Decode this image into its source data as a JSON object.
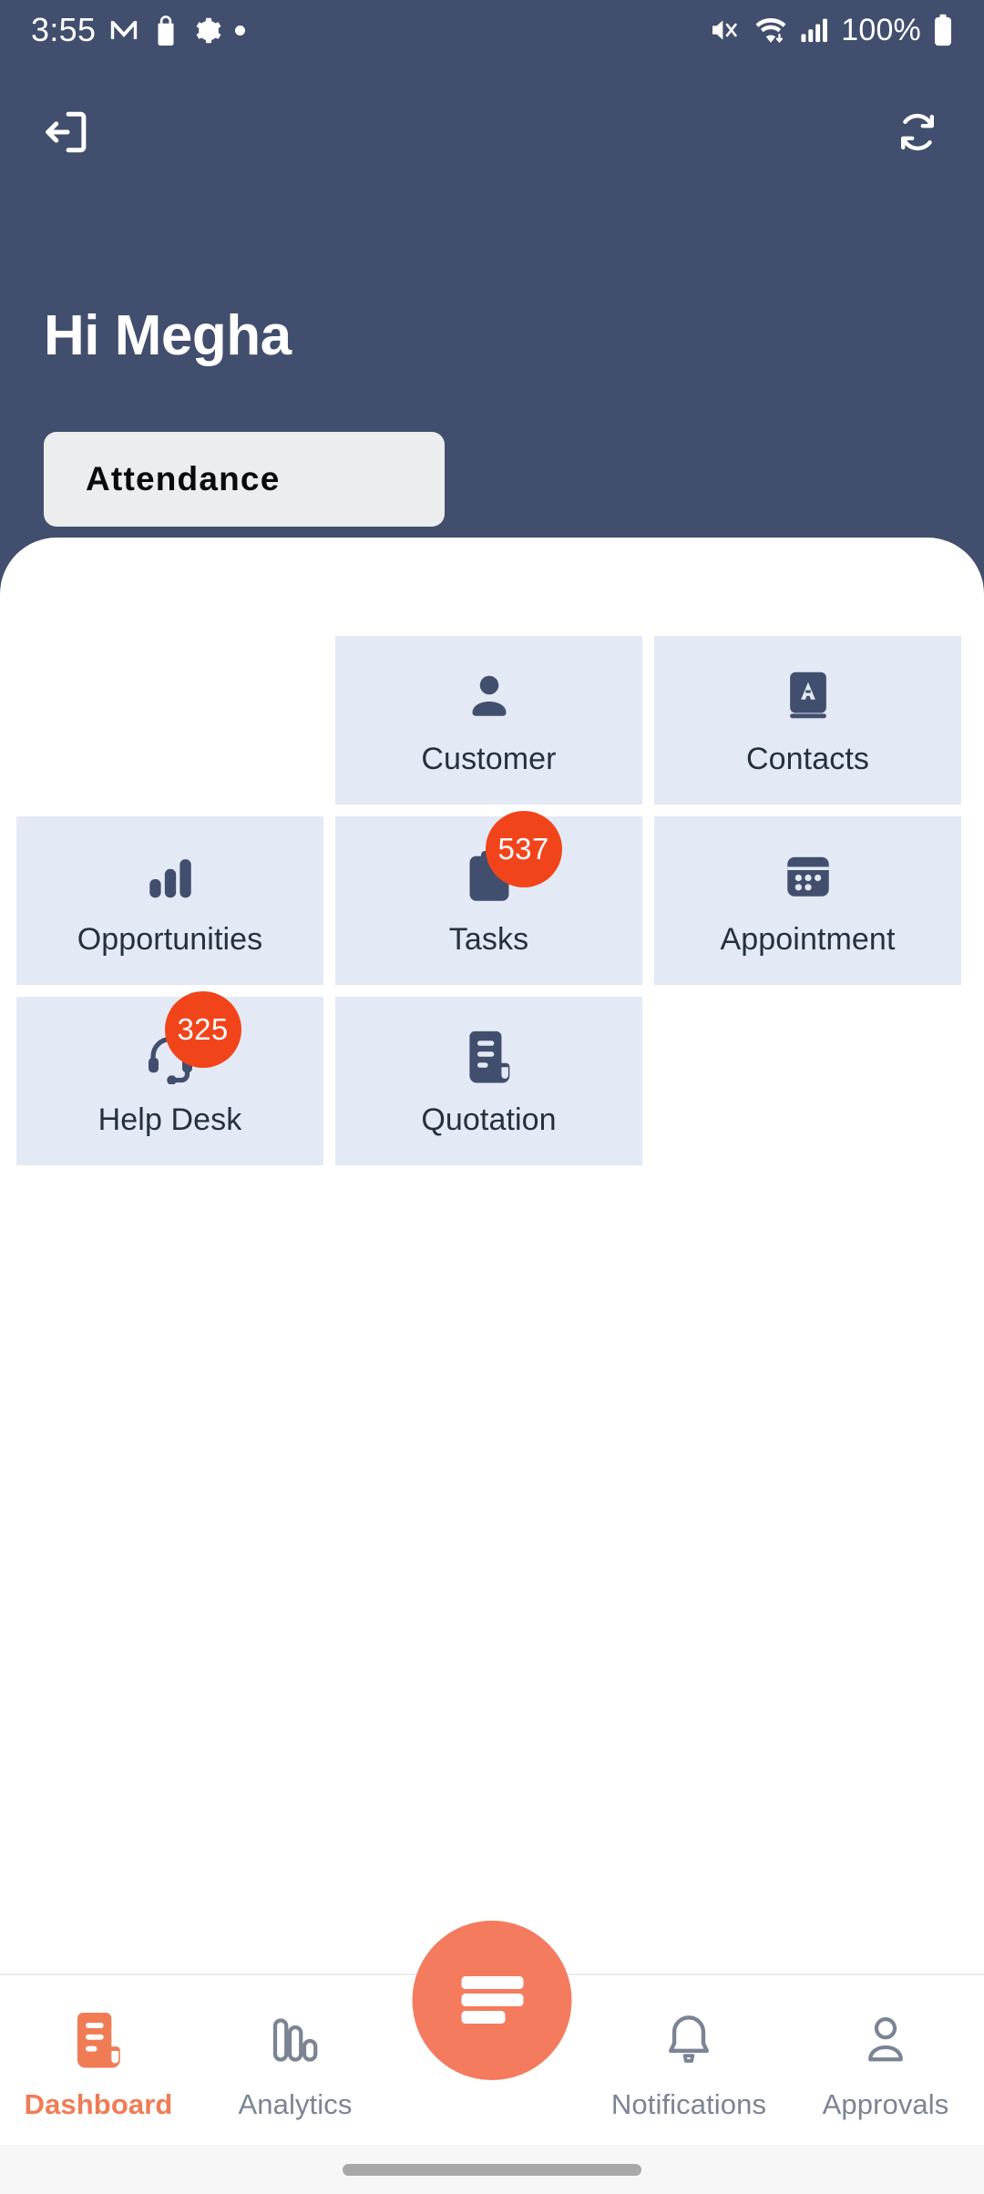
{
  "status_bar": {
    "time": "3:55",
    "battery_percent": "100%",
    "left_icons": [
      "gmail-icon",
      "shopping-bag-icon",
      "gear-icon",
      "dot-icon"
    ],
    "right_icons": [
      "mute-icon",
      "wifi-icon",
      "cellular-signal-icon",
      "battery-icon"
    ]
  },
  "header": {
    "logout_icon": "logout-icon",
    "refresh_icon": "refresh-icon",
    "greeting": "Hi Megha",
    "attendance_label": "Attendance",
    "background_color": "#414E6D"
  },
  "grid": {
    "tile_color": "#E3EAF5",
    "badge_color": "#F2441B",
    "icon_color": "#414E6D",
    "tiles": [
      {
        "label": "",
        "icon": "",
        "badge": null,
        "empty": true
      },
      {
        "label": "Customer",
        "icon": "person-icon",
        "badge": null,
        "empty": false
      },
      {
        "label": "Contacts",
        "icon": "address-book-icon",
        "badge": null,
        "empty": false
      },
      {
        "label": "Opportunities",
        "icon": "bar-chart-icon",
        "badge": null,
        "empty": false
      },
      {
        "label": "Tasks",
        "icon": "clipboard-icon",
        "badge": "537",
        "empty": false
      },
      {
        "label": "Appointment",
        "icon": "calendar-icon",
        "badge": null,
        "empty": false
      },
      {
        "label": "Help Desk",
        "icon": "headset-icon",
        "badge": "325",
        "empty": false
      },
      {
        "label": "Quotation",
        "icon": "document-icon",
        "badge": null,
        "empty": false
      },
      {
        "label": "",
        "icon": "",
        "badge": null,
        "empty": true
      }
    ]
  },
  "bottom_nav": {
    "accent_color": "#F07C55",
    "inactive_color": "#7B8493",
    "fab_color": "#F47B5E",
    "fab_icon": "hamburger-menu-icon",
    "items": [
      {
        "label": "Dashboard",
        "icon": "document-icon",
        "active": true
      },
      {
        "label": "Analytics",
        "icon": "analytics-bars-icon",
        "active": false
      },
      {
        "label": "Notifications",
        "icon": "bell-icon",
        "active": false
      },
      {
        "label": "Approvals",
        "icon": "person-outline-icon",
        "active": false
      }
    ]
  }
}
